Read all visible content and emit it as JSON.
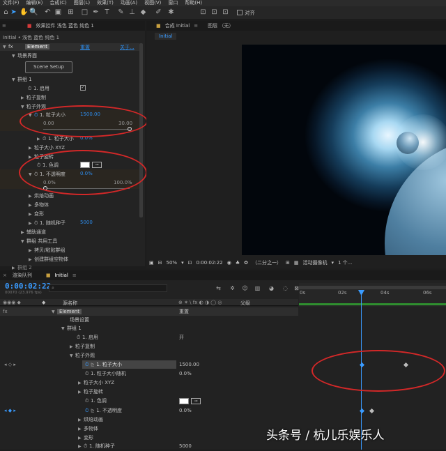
{
  "menu": [
    "文件(F)",
    "编辑(E)",
    "合成(C)",
    "图层(L)",
    "效果(T)",
    "动画(A)",
    "视图(V)",
    "窗口",
    "帮助(H)"
  ],
  "toolbar": {
    "snap_label": "对齐"
  },
  "effects_panel": {
    "tab_label": "效果控件 浅色 蓝色 纯色 1",
    "breadcrumb": "Initial • 浅色 蓝色 纯色 1",
    "effect_name": "Element",
    "reset": "重置",
    "about": "关于...",
    "scene_interface": "场景界面",
    "scene_setup": "Scene Setup",
    "group": "群组 1",
    "enable": "1. 启用",
    "particle_copy": "粒子复制",
    "particle_look": "粒子外观",
    "particle_size": "1. 粒子大小",
    "particle_size_value": "1500.00",
    "slider_min": "0.00",
    "slider_max": "30.00",
    "particle_size_random": "1. 粒子大小",
    "particle_size_random_value": "0.0%",
    "particle_size_xyz": "粒子大小 XYZ",
    "particle_rotation": "粒子旋转",
    "color_tone": "1. 色调",
    "opacity": "1. 不透明度",
    "opacity_value": "0.0%",
    "opacity_min": "0.0%",
    "opacity_max": "100.0%",
    "bake_anim": "烘焙动画",
    "multi_object": "多物体",
    "deform": "变形",
    "random_seed": "1. 随机种子",
    "random_seed_value": "5000",
    "aux_channel": "辅助通道",
    "group_common": "群组 共用工具",
    "copy_paste": "拷贝/粘贴群组",
    "create_null": "创建群组空物体",
    "more": "群组 2"
  },
  "comp_panel": {
    "tab_label": "合成 Initial",
    "layer_tab": "图层 （无）",
    "sub_tab": "Initial"
  },
  "viewer_bar": {
    "zoom": "50%",
    "timecode": "0:00:02:22",
    "resolution": "（二分之一）",
    "camera": "活动摄像机",
    "views": "1 个..."
  },
  "timeline": {
    "queue_tab": "渲染队列",
    "comp_tab": "Initial",
    "timecode": "0:00:02:22",
    "frame_info": "00070 (23.976 fps)",
    "search_placeholder": "",
    "col_source": "源名称",
    "col_parent": "父级",
    "ruler": [
      "0s",
      "02s",
      "04s",
      "06s"
    ],
    "rows": {
      "element": "Element",
      "reset": "重置",
      "scene_settings": "场景设置",
      "group": "群组 1",
      "enable": "1. 启用",
      "enable_value": "开",
      "particle_copy": "粒子复制",
      "particle_look": "粒子外观",
      "size": "1. 粒子大小",
      "size_value": "1500.00",
      "size_random": "1. 粒子大小随机",
      "size_random_value": "0.0%",
      "size_xyz": "粒子大小 XYZ",
      "rotation": "粒子旋转",
      "tone": "1. 色调",
      "opacity": "1. 不透明度",
      "opacity_value": "0.0%",
      "bake": "烘焙动画",
      "multi": "多物体",
      "deform": "变形",
      "seed": "1. 随机种子",
      "seed_value": "5000"
    }
  },
  "watermark": "头条号 / 杭儿乐娱乐人"
}
